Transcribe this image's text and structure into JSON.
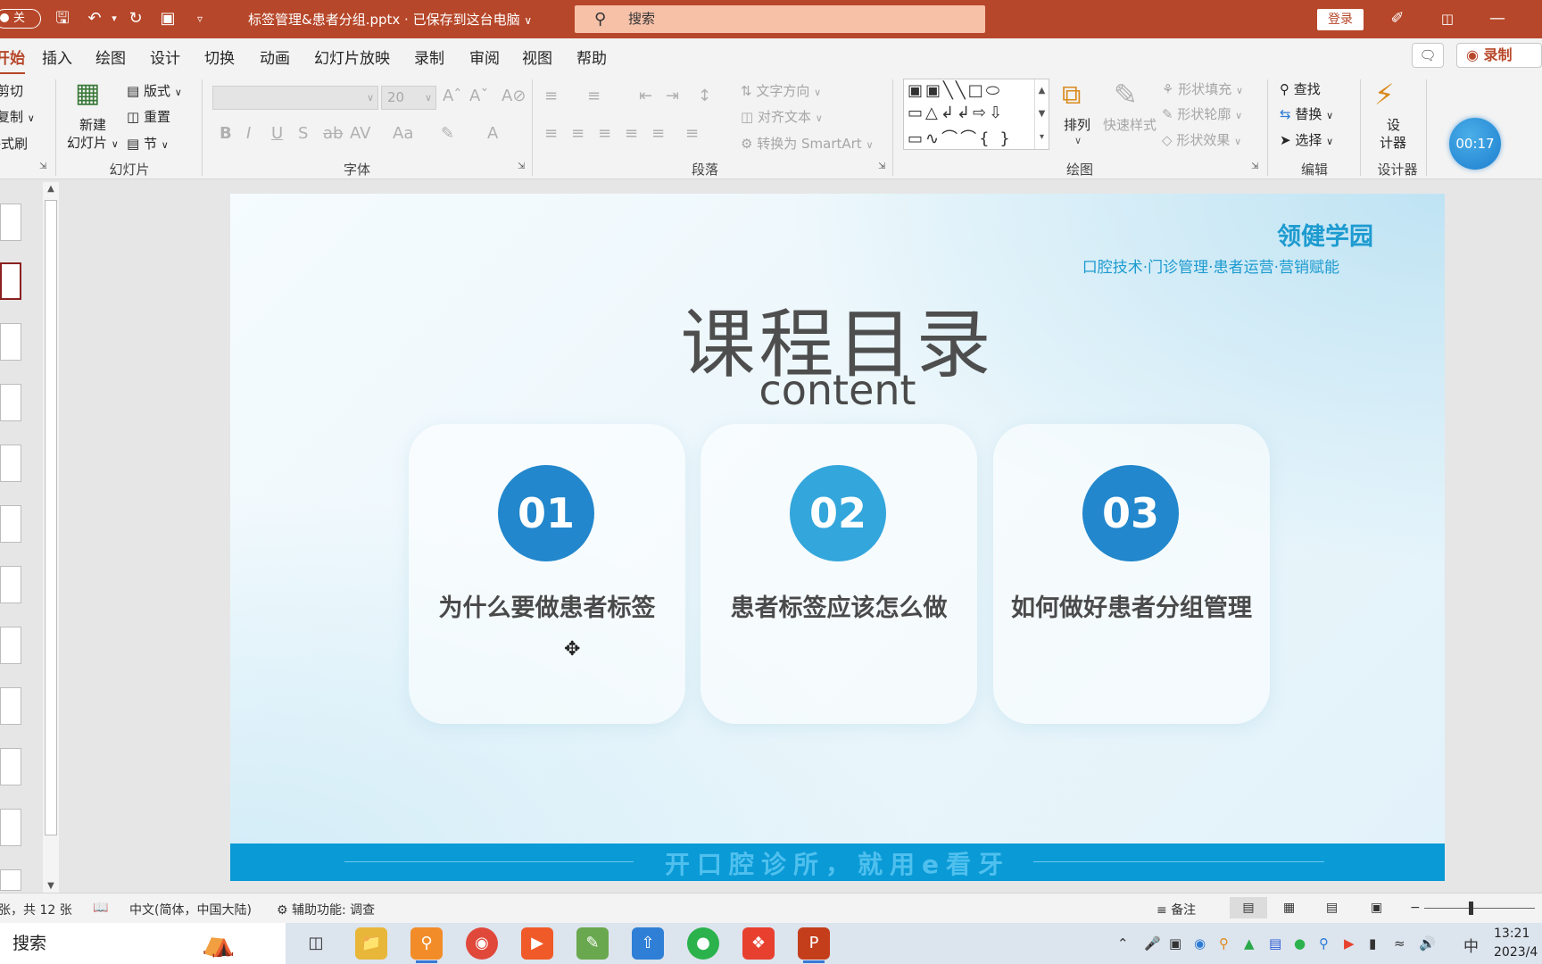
{
  "titlebar": {
    "autosave": "关",
    "document_title": "标签管理&患者分组.pptx · 已保存到这台电脑",
    "search_placeholder": "搜索",
    "login": "登录",
    "accent_color": "#b7472a"
  },
  "tabs": [
    "开始",
    "插入",
    "绘图",
    "设计",
    "切换",
    "动画",
    "幻灯片放映",
    "录制",
    "审阅",
    "视图",
    "帮助"
  ],
  "record_button": "录制",
  "ribbon": {
    "clipboard": {
      "cut": "剪切",
      "copy": "复制",
      "format_painter": "格式刷"
    },
    "slides": {
      "new_slide_1": "新建",
      "new_slide_2": "幻灯片",
      "layout": "版式",
      "reset": "重置",
      "section": "节",
      "group_label": "幻灯片"
    },
    "font": {
      "size": "20",
      "group_label": "字体"
    },
    "paragraph": {
      "text_direction": "文字方向",
      "align_text": "对齐文本",
      "smartart": "转换为 SmartArt",
      "group_label": "段落"
    },
    "drawing": {
      "arrange": "排列",
      "quick_styles": "快速样式",
      "shape_fill": "形状填充",
      "shape_outline": "形状轮廓",
      "shape_effects": "形状效果",
      "group_label": "绘图"
    },
    "editing": {
      "find": "查找",
      "replace": "替换",
      "select": "选择",
      "group_label": "编辑"
    },
    "designer": {
      "label_1": "设",
      "label_2": "计器",
      "group_label": "设计器"
    },
    "timer": "00:17"
  },
  "slide": {
    "brand": "领健学园",
    "tagline": "口腔技术·门诊管理·患者运营·营销赋能",
    "title": "课程目录",
    "subtitle": "content",
    "items": [
      {
        "num": "01",
        "text": "为什么要做患者标签",
        "color": "#2287cc"
      },
      {
        "num": "02",
        "text": "患者标签应该怎么做",
        "color": "#33a6dc"
      },
      {
        "num": "03",
        "text": "如何做好患者分组管理",
        "color": "#2287cc"
      }
    ],
    "footer": "开口腔诊所，就用e看牙"
  },
  "status": {
    "slide_count": "张，共 12 张",
    "language": "中文(简体，中国大陆)",
    "accessibility": "辅助功能: 调查",
    "notes": "备注"
  },
  "taskbar": {
    "search": "搜索",
    "ime": "中",
    "time": "13:21",
    "date": "2023/4"
  }
}
